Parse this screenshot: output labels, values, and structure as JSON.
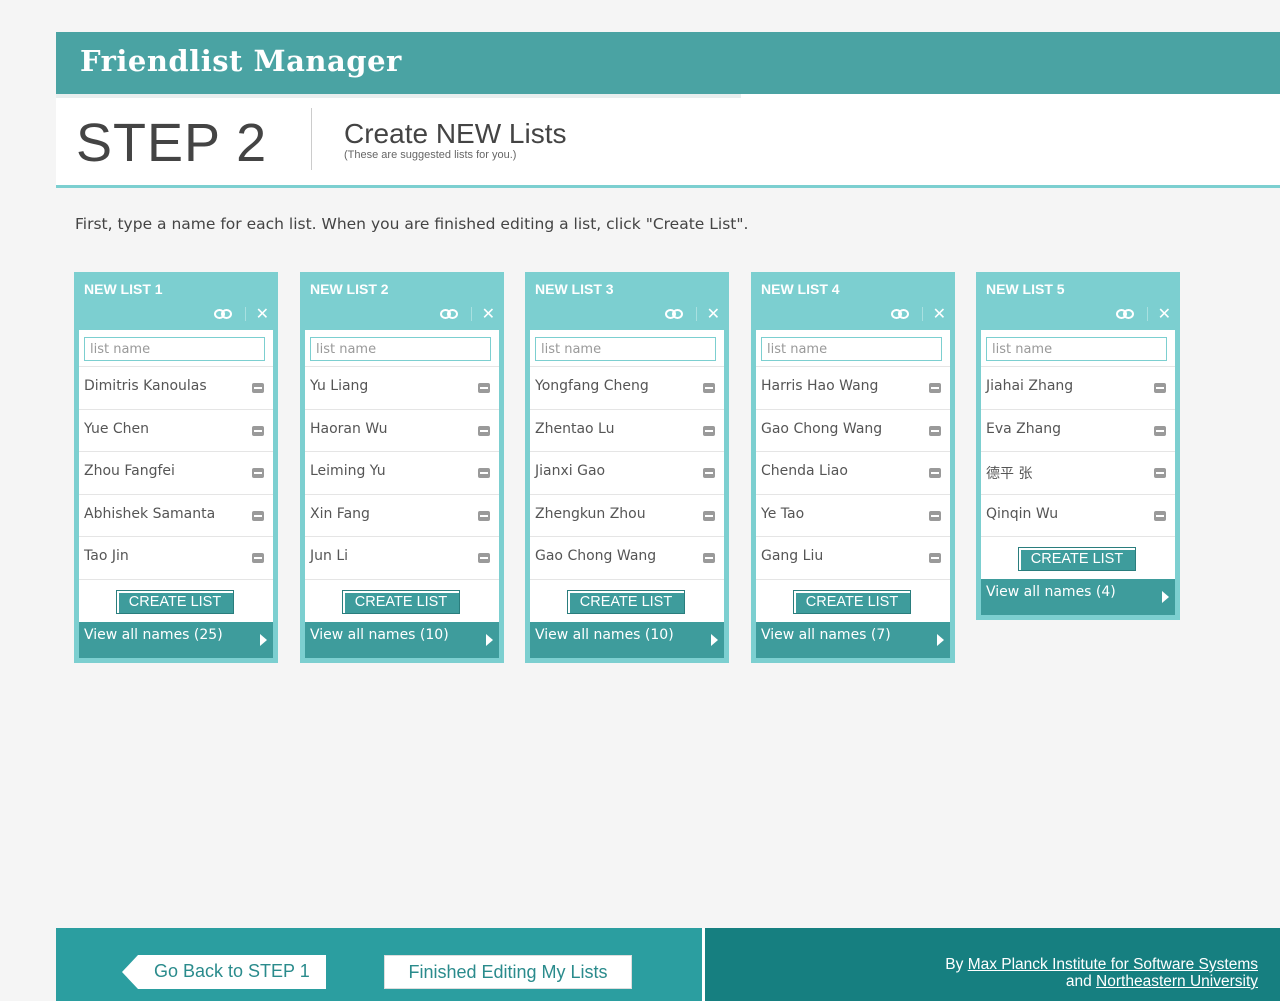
{
  "app": {
    "title": "Friendlist Manager"
  },
  "step": {
    "label": "STEP 2",
    "heading": "Create NEW Lists",
    "subheading": "(These are suggested lists for you.)"
  },
  "instructions": "First, type a name for each list. When you are finished editing a list, click \"Create List\".",
  "lists": [
    {
      "title": "NEW LIST 1",
      "name_placeholder": "list name",
      "members": [
        "Dimitris Kanoulas",
        "Yue Chen",
        "Zhou Fangfei",
        "Abhishek Samanta",
        "Tao Jin"
      ],
      "create_label": "CREATE LIST",
      "view_all_label": "View all names (25)"
    },
    {
      "title": "NEW LIST 2",
      "name_placeholder": "list name",
      "members": [
        "Yu Liang",
        "Haoran Wu",
        "Leiming Yu",
        "Xin Fang",
        "Jun Li"
      ],
      "create_label": "CREATE LIST",
      "view_all_label": "View all names (10)"
    },
    {
      "title": "NEW LIST 3",
      "name_placeholder": "list name",
      "members": [
        "Yongfang Cheng",
        "Zhentao Lu",
        "Jianxi Gao",
        "Zhengkun Zhou",
        "Gao Chong Wang"
      ],
      "create_label": "CREATE LIST",
      "view_all_label": "View all names (10)"
    },
    {
      "title": "NEW LIST 4",
      "name_placeholder": "list name",
      "members": [
        "Harris Hao Wang",
        "Gao Chong Wang",
        "Chenda Liao",
        "Ye Tao",
        "Gang Liu"
      ],
      "create_label": "CREATE LIST",
      "view_all_label": "View all names (7)"
    },
    {
      "title": "NEW LIST 5",
      "name_placeholder": "list name",
      "members": [
        "Jiahai Zhang",
        "Eva Zhang",
        "德平 张",
        "Qinqin Wu"
      ],
      "create_label": "CREATE LIST",
      "view_all_label": "View all names (4)"
    }
  ],
  "footer": {
    "back_label": "Go Back to STEP 1",
    "finish_label": "Finished Editing My Lists",
    "credit_by": "By",
    "credit_org1": "Max Planck Institute for Software Systems",
    "credit_and": "and",
    "credit_org2": "Northeastern University"
  },
  "colors": {
    "header_teal": "#4aa3a3",
    "card_light_teal": "#7ccfd0",
    "button_teal": "#3e9c9c",
    "footer_teal": "#2b9ea0",
    "footer_dark_teal": "#167f80"
  },
  "icons": {
    "merge": "merge-icon",
    "close": "close-icon",
    "remove": "remove-icon",
    "arrow": "arrow-right-icon"
  }
}
